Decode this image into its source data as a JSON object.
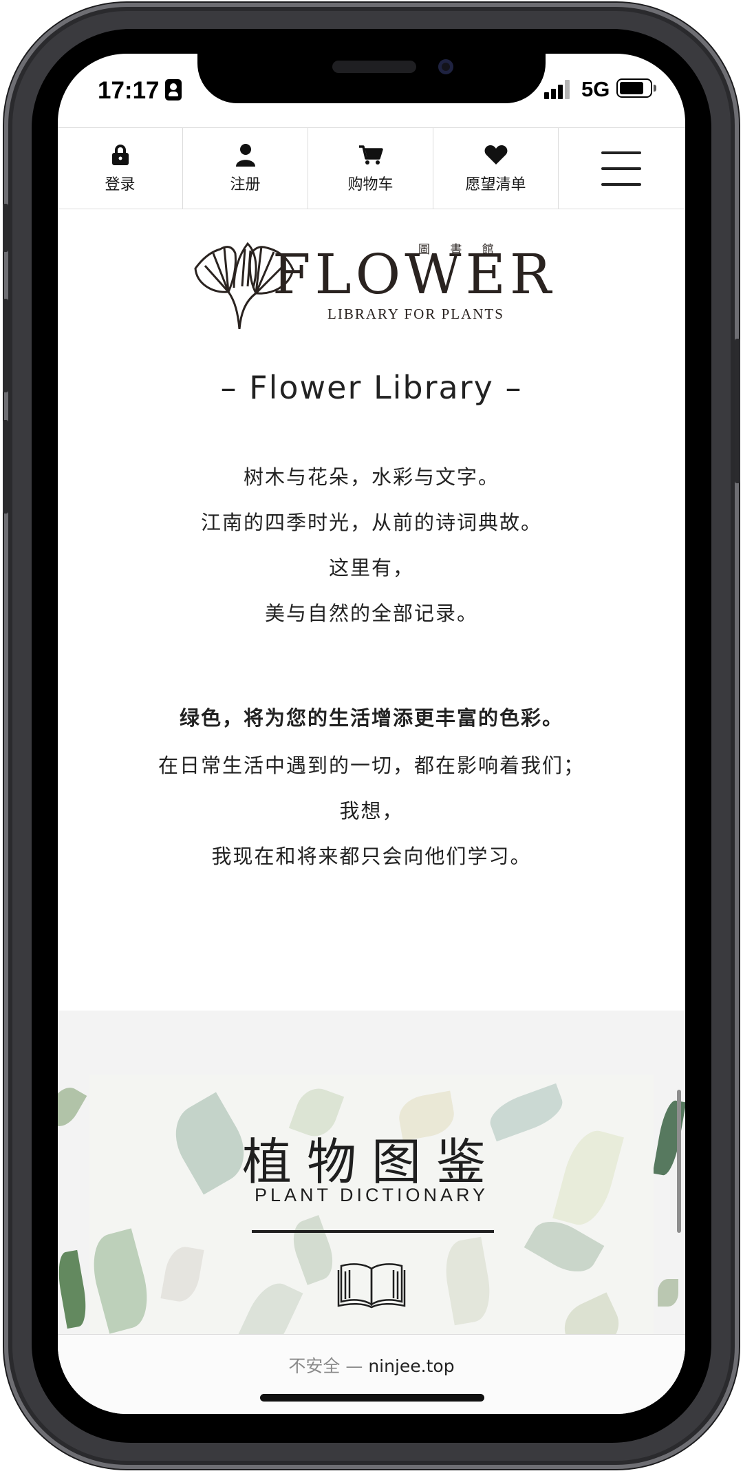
{
  "status_bar": {
    "time": "17:17",
    "network": "5G",
    "battery_percent": 70
  },
  "nav": {
    "items": [
      {
        "label": "登录",
        "icon": "lock-icon"
      },
      {
        "label": "注册",
        "icon": "user-icon"
      },
      {
        "label": "购物车",
        "icon": "cart-icon"
      },
      {
        "label": "愿望清单",
        "icon": "heart-icon"
      }
    ],
    "menu_icon": "hamburger-menu-icon"
  },
  "logo": {
    "kanji": "圖 書 館",
    "wordmark": "FLOWER",
    "tagline": "LIBRARY FOR PLANTS"
  },
  "intro": {
    "title": "– Flower Library –",
    "paragraph1": [
      "树木与花朵，水彩与文字。",
      "江南的四季时光，从前的诗词典故。",
      "这里有，",
      "美与自然的全部记录。"
    ],
    "paragraph2_heading": "绿色，将为您的生活增添更丰富的色彩。",
    "paragraph2": [
      "在日常生活中遇到的一切，都在影响着我们；",
      "我想，",
      "我现在和将来都只会向他们学习。"
    ]
  },
  "banner": {
    "title": "植物图鉴",
    "subtitle": "PLANT DICTIONARY",
    "icon": "open-book-icon"
  },
  "browser": {
    "insecure_label": "不安全 —",
    "domain": "ninjee.top"
  },
  "colors": {
    "ink": "#2a2320",
    "text": "#222222",
    "section_bg": "#f3f3f3"
  }
}
